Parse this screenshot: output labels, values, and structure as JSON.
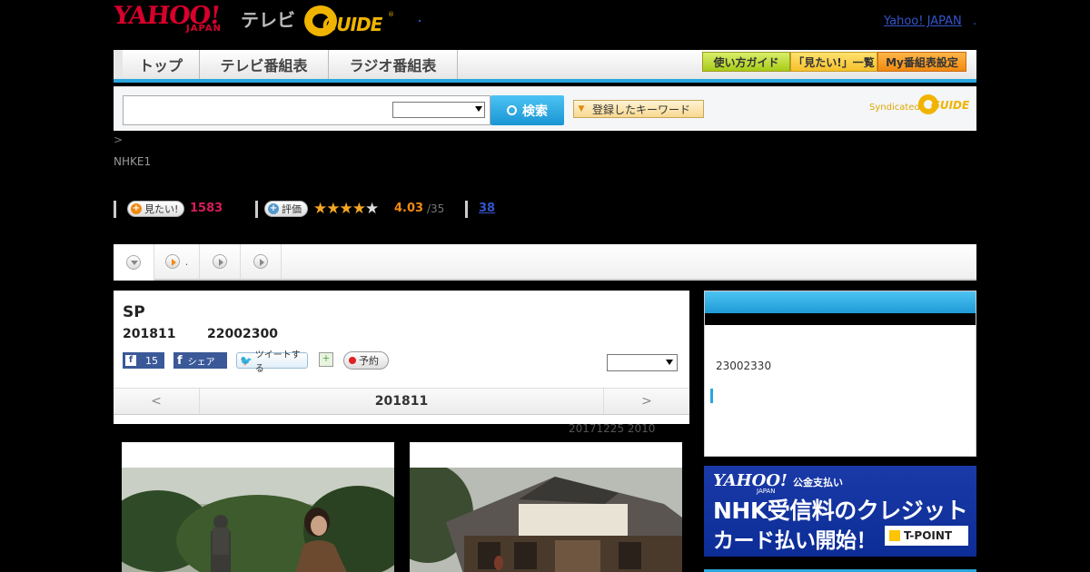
{
  "header": {
    "logo_yahoo": "YAHOO!",
    "logo_japan": "JAPAN",
    "logo_tv": "テレビ",
    "gguide_text": "GUIDE",
    "yahoo_japan_link": "Yahoo! JAPAN",
    "extra_link": "."
  },
  "nav": {
    "tabs": [
      "トップ",
      "テレビ番組表",
      "ラジオ番組表"
    ],
    "buttons": [
      "使い方ガイド",
      "「見たい!」一覧",
      "My番組表設定"
    ]
  },
  "search": {
    "input_value": "",
    "select_value": "",
    "button_label": "検索",
    "keyword_button": "登録したキーワード",
    "syndicated_label": "Syndicated",
    "syndicated_logo": "GUIDE"
  },
  "program_info": {
    "breadcrumb": " > ",
    "channel": "NHKE1",
    "want_label": "見たい!",
    "want_count": "1583",
    "rating_label": "評価",
    "stars": "★★★★",
    "empty_star": "★",
    "rating_score": "4.03",
    "rating_total": "/35",
    "review_count": "38"
  },
  "tabs_strip": {
    "tab2_text": "."
  },
  "program": {
    "title": "SP",
    "date": "201811",
    "time_code": "22002300",
    "fb_count": "15",
    "fb_share": "シェア",
    "tweet": "ツイートする",
    "reserve": "予約",
    "select_value": "",
    "prev": "<",
    "current": "201811",
    "next": ">",
    "updated": "20171225  2010"
  },
  "side": {
    "time": "23002330"
  },
  "banner": {
    "yahoo": "YAHOO!",
    "japan": "JAPAN",
    "subtitle": "公金支払い",
    "line1": "NHK受信料のクレジット",
    "line2": "カード払い開始！",
    "tpoint": "T-POINT"
  },
  "colors": {
    "accent_blue": "#2aa6dc",
    "yahoo_red": "#d9002d",
    "gguide_gold": "#f0b400",
    "want_pink": "#d81b5a",
    "star_orange": "#f5a623"
  }
}
